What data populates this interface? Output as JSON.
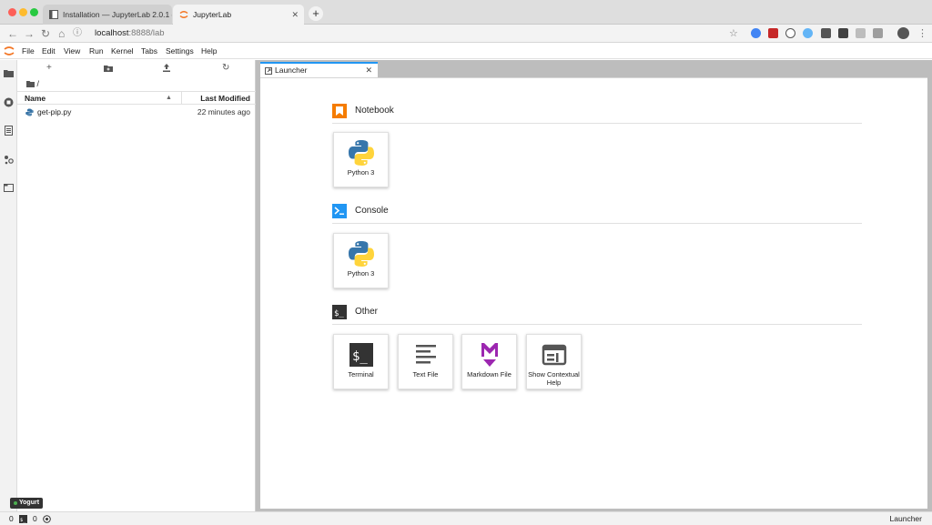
{
  "browser": {
    "tabs": [
      {
        "title": "Installation — JupyterLab 2.0.1 d"
      },
      {
        "title": "JupyterLab"
      }
    ],
    "url_host": "localhost",
    "url_rest": ":8888/lab"
  },
  "menu": {
    "items": [
      "File",
      "Edit",
      "View",
      "Run",
      "Kernel",
      "Tabs",
      "Settings",
      "Help"
    ]
  },
  "filebrowser": {
    "breadcrumb": "/",
    "col_name": "Name",
    "col_modified": "Last Modified",
    "files": [
      {
        "name": "get-pip.py",
        "modified": "22 minutes ago"
      }
    ]
  },
  "doc_tab": {
    "title": "Launcher"
  },
  "launcher": {
    "sections": [
      {
        "title": "Notebook",
        "cards": [
          {
            "label": "Python 3"
          }
        ]
      },
      {
        "title": "Console",
        "cards": [
          {
            "label": "Python 3"
          }
        ]
      },
      {
        "title": "Other",
        "cards": [
          {
            "label": "Terminal"
          },
          {
            "label": "Text File"
          },
          {
            "label": "Markdown File"
          },
          {
            "label_line1": "Show Contextual",
            "label_line2": "Help"
          }
        ]
      }
    ]
  },
  "statusbar": {
    "terminals": "0",
    "kernels": "0",
    "right": "Launcher",
    "badge": "Yogurt"
  },
  "colors": {
    "accent": "#2196f3",
    "notebook": "#f57c00",
    "console": "#2196f3",
    "other": "#333333",
    "markdown": "#9c27b0"
  }
}
